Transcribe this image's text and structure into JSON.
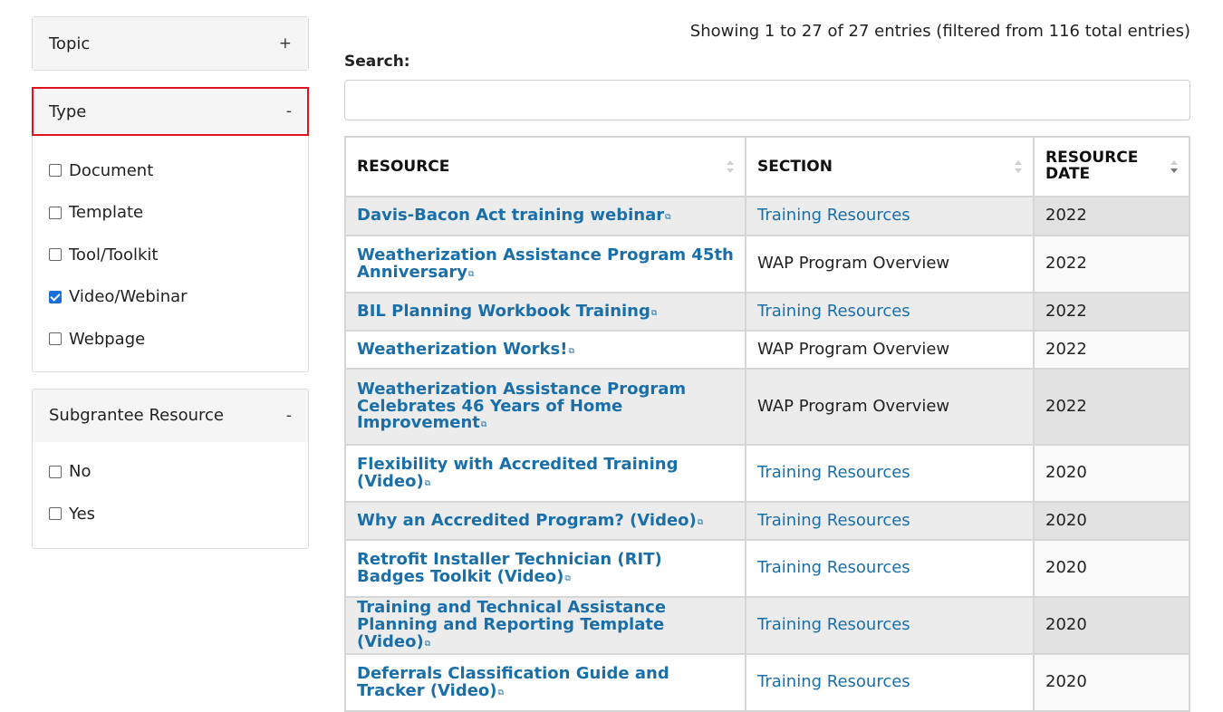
{
  "filters": {
    "topic": {
      "label": "Topic",
      "toggle": "+"
    },
    "type": {
      "label": "Type",
      "toggle": "-",
      "options": [
        {
          "label": "Document",
          "checked": false
        },
        {
          "label": "Template",
          "checked": false
        },
        {
          "label": "Tool/Toolkit",
          "checked": false
        },
        {
          "label": "Video/Webinar",
          "checked": true
        },
        {
          "label": "Webpage",
          "checked": false
        }
      ]
    },
    "subgrantee": {
      "label": "Subgrantee Resource",
      "toggle": "-",
      "options": [
        {
          "label": "No",
          "checked": false
        },
        {
          "label": "Yes",
          "checked": false
        }
      ]
    }
  },
  "table_info": "Showing 1 to 27 of 27 entries (filtered from 116 total entries)",
  "search": {
    "label": "Search:",
    "value": ""
  },
  "table": {
    "columns": [
      "RESOURCE",
      "SECTION",
      "RESOURCE DATE"
    ],
    "rows": [
      {
        "resource": "Davis-Bacon Act training webinar",
        "section": "Training Resources",
        "section_link": true,
        "date": "2022"
      },
      {
        "resource": "Weatherization Assistance Program 45th Anniversary",
        "section": "WAP Program Overview",
        "section_link": false,
        "date": "2022"
      },
      {
        "resource": "BIL Planning Workbook Training",
        "section": "Training Resources",
        "section_link": true,
        "date": "2022"
      },
      {
        "resource": "Weatherization Works!",
        "section": "WAP Program Overview",
        "section_link": false,
        "date": "2022"
      },
      {
        "resource": "Weatherization Assistance Program Celebrates 46 Years of Home Improvement",
        "section": "WAP Program Overview",
        "section_link": false,
        "date": "2022"
      },
      {
        "resource": "Flexibility with Accredited Training (Video)",
        "section": "Training Resources",
        "section_link": true,
        "date": "2020"
      },
      {
        "resource": "Why an Accredited Program? (Video)",
        "section": "Training Resources",
        "section_link": true,
        "date": "2020"
      },
      {
        "resource": "Retrofit Installer Technician (RIT) Badges Toolkit (Video)",
        "section": "Training Resources",
        "section_link": true,
        "date": "2020"
      },
      {
        "resource": "Training and Technical Assistance Planning and Reporting Template (Video)",
        "section": "Training Resources",
        "section_link": true,
        "date": "2020"
      },
      {
        "resource": "Deferrals Classification Guide and Tracker (Video)",
        "section": "Training Resources",
        "section_link": true,
        "date": "2020"
      }
    ]
  },
  "colors": {
    "link": "#1b6fa8",
    "highlight": "#e0141e",
    "checkbox_checked": "#1a6ed8"
  },
  "icons": {
    "external_link": "external-link-icon",
    "sort": "sort-icon"
  }
}
